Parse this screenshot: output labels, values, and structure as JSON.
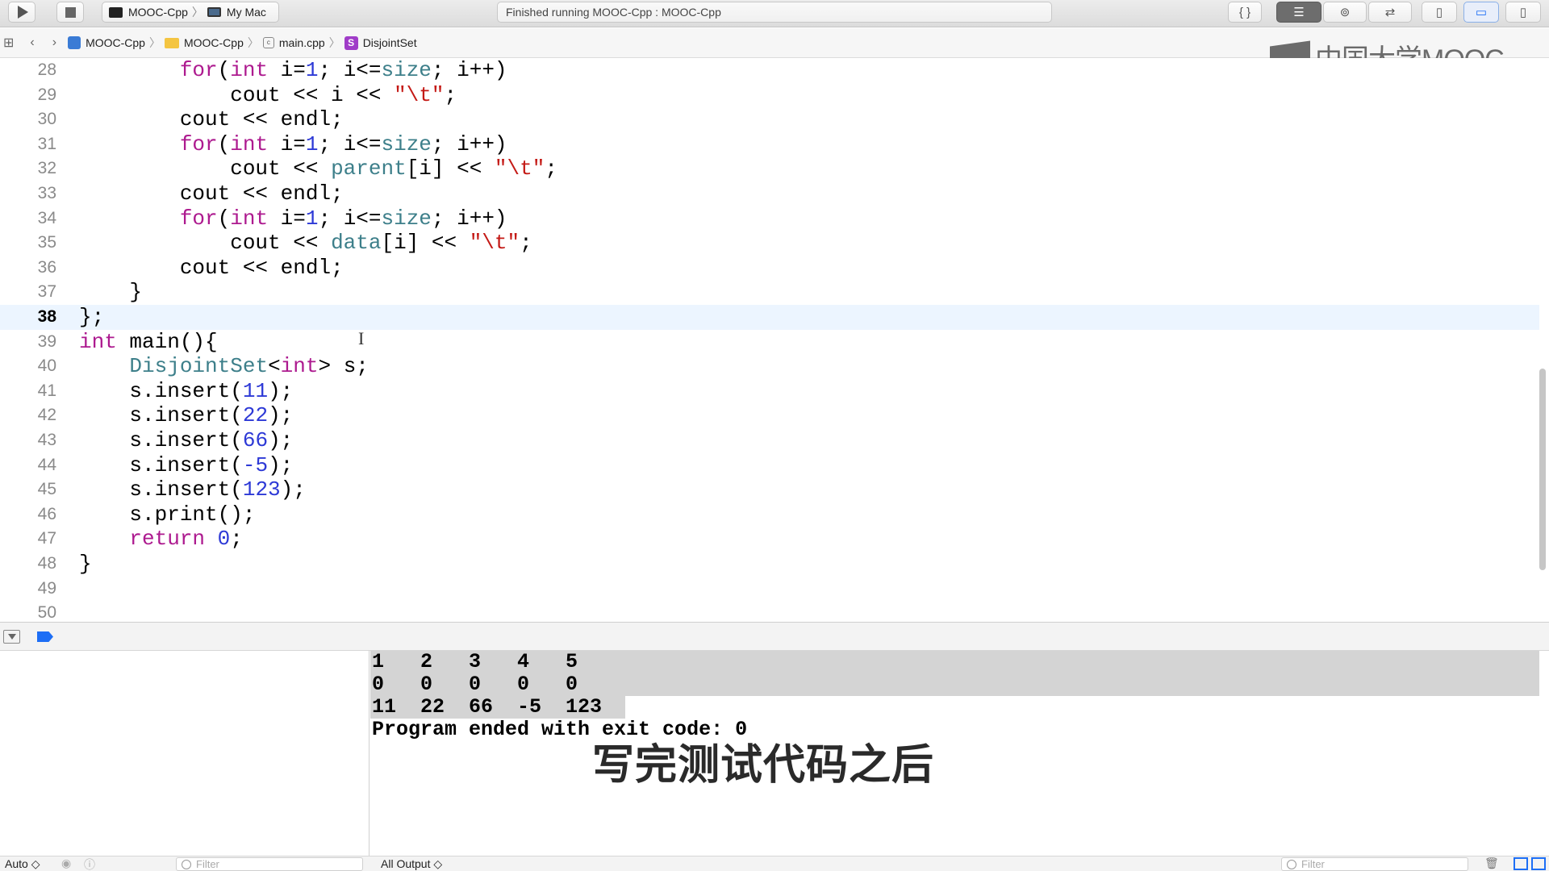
{
  "toolbar": {
    "scheme": "MOOC-Cpp",
    "destination": "My Mac",
    "activity_status": "Finished running MOOC-Cpp : MOOC-Cpp"
  },
  "jumpbar": {
    "crumbs": [
      "MOOC-Cpp",
      "MOOC-Cpp",
      "main.cpp",
      "DisjointSet"
    ]
  },
  "watermark": "中国大学MOOC",
  "editor": {
    "current_line": "38",
    "lines": [
      {
        "n": "28"
      },
      {
        "n": "29"
      },
      {
        "n": "30"
      },
      {
        "n": "31"
      },
      {
        "n": "32"
      },
      {
        "n": "33"
      },
      {
        "n": "34"
      },
      {
        "n": "35"
      },
      {
        "n": "36"
      },
      {
        "n": "37"
      },
      {
        "n": "38"
      },
      {
        "n": "39"
      },
      {
        "n": "40"
      },
      {
        "n": "41"
      },
      {
        "n": "42"
      },
      {
        "n": "43"
      },
      {
        "n": "44"
      },
      {
        "n": "45"
      },
      {
        "n": "46"
      },
      {
        "n": "47"
      },
      {
        "n": "48"
      },
      {
        "n": "49"
      },
      {
        "n": "50"
      }
    ],
    "code_text": {
      "l28": "        for(int i=1; i<=size; i++)",
      "l29": "            cout << i << \"\\t\";",
      "l30": "        cout << endl;",
      "l31": "        for(int i=1; i<=size; i++)",
      "l32": "            cout << parent[i] << \"\\t\";",
      "l33": "        cout << endl;",
      "l34": "        for(int i=1; i<=size; i++)",
      "l35": "            cout << data[i] << \"\\t\";",
      "l36": "        cout << endl;",
      "l37": "    }",
      "l38": "};",
      "l39": "int main(){",
      "l40": "    DisjointSet<int> s;",
      "l41": "    s.insert(11);",
      "l42": "    s.insert(22);",
      "l43": "    s.insert(66);",
      "l44": "    s.insert(-5);",
      "l45": "    s.insert(123);",
      "l46": "    s.print();",
      "l47": "    return 0;",
      "l48": "}"
    }
  },
  "console": {
    "lines": [
      "1   2   3   4   5",
      "0   0   0   0   0",
      "11  22  66  -5  123",
      "Program ended with exit code: 0"
    ]
  },
  "subtitle": "写完测试代码之后",
  "bottombar": {
    "variables_scope": "Auto ◇",
    "filter_placeholder": "Filter",
    "output_selector": "All Output ◇"
  },
  "colors": {
    "keyword": "#ad1a8f",
    "number": "#2d39d6",
    "string": "#c41a16",
    "type": "#3d7f8a",
    "current_line_bg": "#ecf5ff"
  }
}
